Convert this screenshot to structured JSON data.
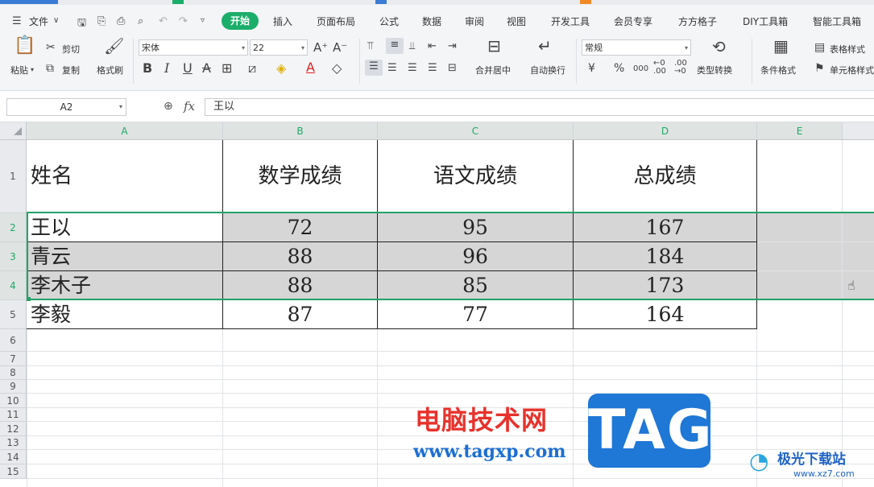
{
  "menu": {
    "file_label": "文件",
    "tabs": [
      "开始",
      "插入",
      "页面布局",
      "公式",
      "数据",
      "审阅",
      "视图",
      "开发工具",
      "会员专享",
      "方方格子",
      "DIY工具箱",
      "智能工具箱"
    ]
  },
  "ribbon": {
    "paste": "粘贴",
    "cut": "剪切",
    "copy": "复制",
    "format_painter": "格式刷",
    "font_name": "宋体",
    "font_size": "22",
    "bold": "B",
    "italic": "I",
    "underline": "U",
    "merge_center": "合并居中",
    "wrap_text": "自动换行",
    "number_format": "常规",
    "currency": "¥",
    "percent": "%",
    "thousands": "000",
    "type_convert": "类型转换",
    "conditional_format": "条件格式",
    "table_style": "表格样式",
    "cell_style": "单元格样式"
  },
  "formula_bar": {
    "name_box": "A2",
    "fx": "fx",
    "value": "王以"
  },
  "columns": [
    "A",
    "B",
    "C",
    "D",
    "E"
  ],
  "rows": [
    "1",
    "2",
    "3",
    "4",
    "5",
    "6",
    "7",
    "8",
    "9",
    "10",
    "11",
    "12",
    "13",
    "14",
    "15"
  ],
  "table": {
    "headers": [
      "姓名",
      "数学成绩",
      "语文成绩",
      "总成绩"
    ],
    "records": [
      {
        "name": "王以",
        "math": "72",
        "chinese": "95",
        "total": "167"
      },
      {
        "name": "青云",
        "math": "88",
        "chinese": "96",
        "total": "184"
      },
      {
        "name": "李木子",
        "math": "88",
        "chinese": "85",
        "total": "173"
      },
      {
        "name": "李毅",
        "math": "87",
        "chinese": "77",
        "total": "164"
      }
    ]
  },
  "watermark": {
    "site_name": "电脑技术网",
    "url": "www.tagxp.com",
    "badge": "TAG",
    "corner": "极光下载站",
    "corner_url": "www.xz7.com"
  },
  "colors": {
    "accent": "#1bae6a",
    "selection_fill": "#d6d6d6",
    "selection_border": "#21a366"
  }
}
